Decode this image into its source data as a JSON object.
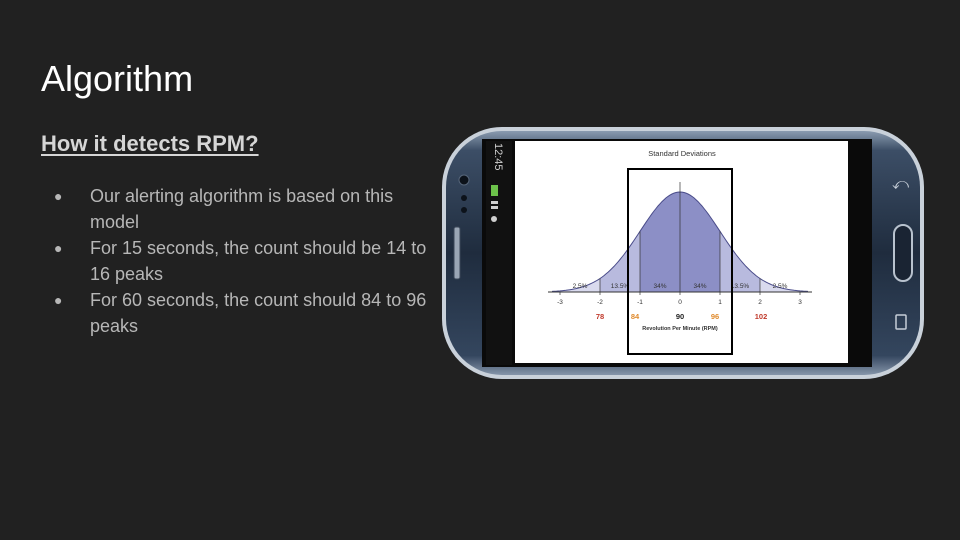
{
  "slide": {
    "title": "Algorithm",
    "subtitle": "How it detects RPM?",
    "bullets": [
      "Our alerting algorithm is based on this model",
      "For 15 seconds,  the count should be 14 to 16 peaks",
      "For 60 seconds, the count should 84 to 96 peaks"
    ]
  },
  "phone": {
    "status_time": "12:45",
    "screen": {
      "chart_data": {
        "type": "area",
        "title": "Standard Deviations",
        "xlabel": "Revolution Per Minute (RPM)",
        "x_ticks": [
          "-3",
          "-2",
          "-1",
          "0",
          "1",
          "2",
          "3"
        ],
        "rpm_labels": [
          {
            "value": "78",
            "color": "#c0392b"
          },
          {
            "value": "84",
            "color": "#e08a2c"
          },
          {
            "value": "90",
            "color": "#222222"
          },
          {
            "value": "96",
            "color": "#e08a2c"
          },
          {
            "value": "102",
            "color": "#c0392b"
          }
        ],
        "region_labels": [
          "2.5%",
          "13.5%",
          "34%",
          "34%",
          "13.5%",
          "2.5%"
        ],
        "colors": {
          "inner": "#8c8fc6",
          "middle": "#b8bade",
          "outer": "#d9daee",
          "highlight_box": "#000000"
        }
      }
    }
  }
}
